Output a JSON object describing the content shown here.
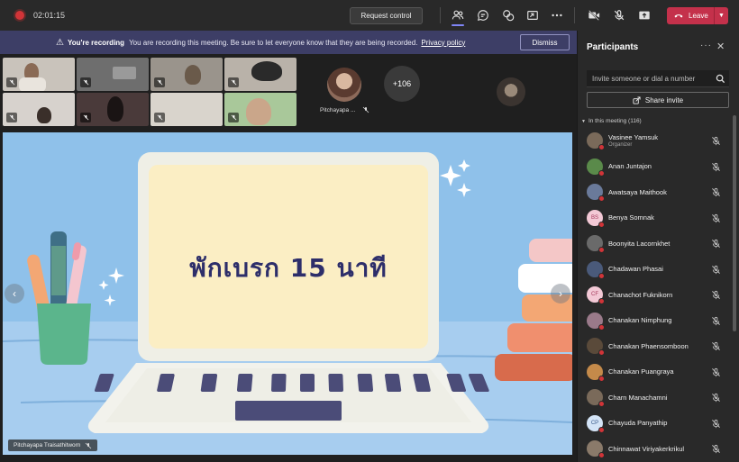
{
  "topbar": {
    "timer": "02:01:15",
    "request_control_label": "Request control",
    "leave_label": "Leave"
  },
  "banner": {
    "title": "You're recording",
    "message": "You are recording this meeting. Be sure to let everyone know that they are being recorded.",
    "link": "Privacy policy",
    "dismiss_label": "Dismiss"
  },
  "gallery": {
    "featured_name": "Pitchayapa ...",
    "more_count": "+106"
  },
  "stage": {
    "slide_text": "พักเบรก 15 นาที",
    "presenter_name": "Pitchayapa Traisathitworn"
  },
  "panel": {
    "title": "Participants",
    "invite_placeholder": "Invite someone or dial a number",
    "share_invite_label": "Share invite",
    "section_label": "In this meeting (116)",
    "participants": [
      {
        "name": "Vasinee Yamsuk",
        "role": "Organizer",
        "initials": "",
        "color": "#7a6a5a"
      },
      {
        "name": "Anan Juntajon",
        "role": "",
        "initials": "",
        "color": "#5a8a4a"
      },
      {
        "name": "Awatsaya Maithook",
        "role": "",
        "initials": "",
        "color": "#6a7a9a"
      },
      {
        "name": "Benya Somnak",
        "role": "",
        "initials": "BS",
        "color": "#f3c9d6"
      },
      {
        "name": "Boonyita Lacornkhet",
        "role": "",
        "initials": "",
        "color": "#6a6a6a"
      },
      {
        "name": "Chadawan Phasai",
        "role": "",
        "initials": "",
        "color": "#4a5a7a"
      },
      {
        "name": "Chanachot Fuknikorn",
        "role": "",
        "initials": "CF",
        "color": "#f3c9d6"
      },
      {
        "name": "Chanakan Nimphung",
        "role": "",
        "initials": "",
        "color": "#9a7a8a"
      },
      {
        "name": "Chanakan Phaensomboon",
        "role": "",
        "initials": "",
        "color": "#5a4a3a"
      },
      {
        "name": "Chanakan Puangraya",
        "role": "",
        "initials": "",
        "color": "#c48a4a"
      },
      {
        "name": "Charn Manachamni",
        "role": "",
        "initials": "",
        "color": "#7a6a5a"
      },
      {
        "name": "Chayuda Panyathip",
        "role": "",
        "initials": "CP",
        "color": "#d4e4f7"
      },
      {
        "name": "Chinnawat Viriyakerkrikul",
        "role": "",
        "initials": "",
        "color": "#8a7a6a"
      }
    ]
  },
  "colors": {
    "accent": "#7f85f5",
    "leave": "#c4314b",
    "banner": "#3d3e66",
    "recording": "#d13438"
  }
}
